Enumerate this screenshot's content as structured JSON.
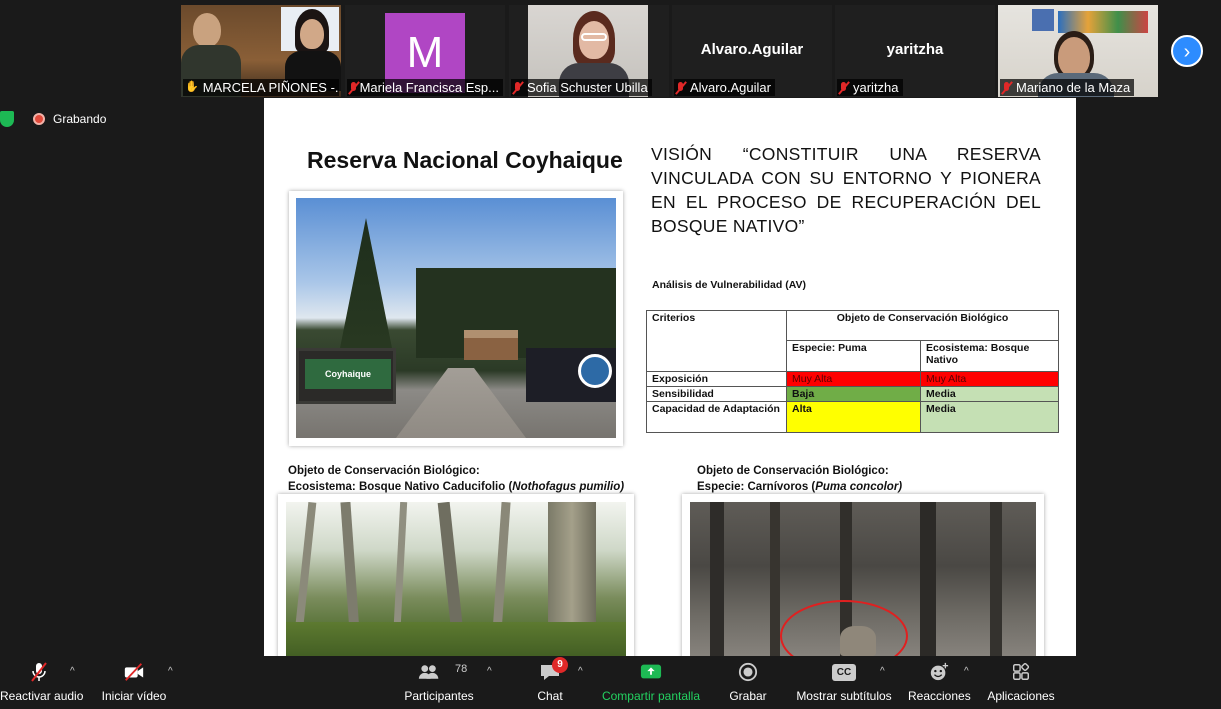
{
  "participants": [
    {
      "name": "MARCELA PIÑONES -...",
      "status": "hand"
    },
    {
      "name": "Mariela Francisca Esp...",
      "initial": "M",
      "status": "muted"
    },
    {
      "name": "Sofia Schuster Ubilla",
      "status": "muted"
    },
    {
      "name": "Alvaro.Aguilar",
      "display": "Alvaro.Aguilar",
      "status": "muted"
    },
    {
      "name": "yaritzha",
      "display": "yaritzha",
      "status": "muted"
    },
    {
      "name": "Mariano de la Maza",
      "status": "muted"
    }
  ],
  "recording": {
    "label": "Grabando"
  },
  "slide": {
    "title": "Reserva Nacional Coyhaique",
    "vision": "VISIÓN “CONSTITUIR UNA RESERVA VINCULADA CON SU ENTORNO Y PIONERA EN EL PROCESO DE RECUPERACIÓN DEL BOSQUE NATIVO”",
    "sign_text": "Coyhaique",
    "av_title": "Análisis de Vulnerabilidad (AV)",
    "table": {
      "col_criterios": "Criterios",
      "col_objeto": "Objeto  de Conservación Biológico",
      "sub_puma": "Especie: Puma",
      "sub_bosque": "Ecosistema: Bosque Nativo",
      "rows": [
        {
          "criterio": "Exposición",
          "puma": "Muy Alta",
          "bosque": "Muy Alta"
        },
        {
          "criterio": "Sensibilidad",
          "puma": "Baja",
          "bosque": "Media"
        },
        {
          "criterio": "Capacidad de Adaptación",
          "puma": "Alta",
          "bosque": "Media"
        }
      ]
    },
    "caption_left_1": "Objeto de Conservación Biológico:",
    "caption_left_2": "Ecosistema: Bosque Nativo Caducifolio (",
    "caption_left_italic": "Nothofagus pumilio)",
    "caption_right_1": "Objeto de Conservación Biológico:",
    "caption_right_2": "Especie: Carnívoros (",
    "caption_right_italic": "Puma concolor)",
    "caption_right_end": ")"
  },
  "colors": {
    "muy_alta": "#ff0000",
    "baja": "#70ad47",
    "alta": "#ffff00",
    "media": "#c5e0b4"
  },
  "toolbar": {
    "audio": "Reactivar audio",
    "video": "Iniciar vídeo",
    "participants": "Participantes",
    "participants_count": "78",
    "chat": "Chat",
    "chat_badge": "9",
    "share": "Compartir pantalla",
    "record": "Grabar",
    "subtitles": "Mostrar subtítulos",
    "subtitles_icon": "CC",
    "reactions": "Reacciones",
    "apps": "Aplicaciones"
  }
}
